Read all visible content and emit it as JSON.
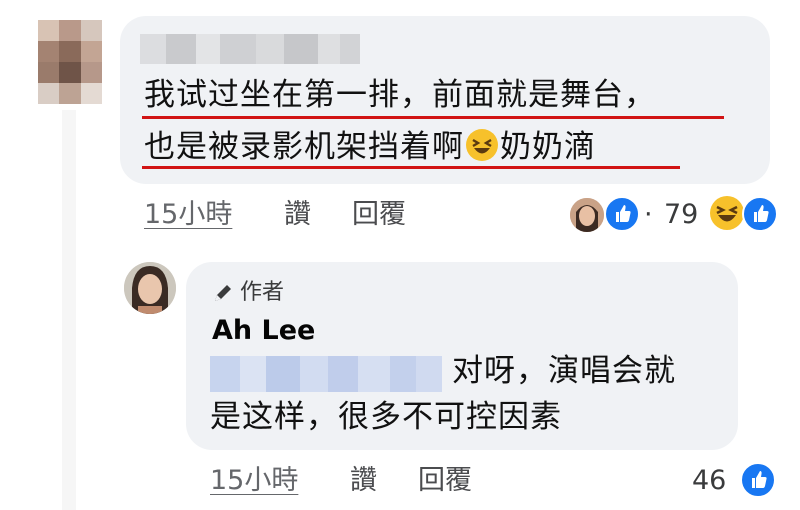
{
  "comment": {
    "text_line1": "我试过坐在第一排，前面就是舞台，",
    "text_line2_before_emoji": "也是被录影机架挡着啊",
    "text_line2_after_emoji": "奶奶滴",
    "time": "15小時",
    "like_label": "讚",
    "reply_label": "回覆",
    "reactions_separator": "·",
    "reactions_count": "79",
    "emoji": "laughing-face"
  },
  "reply": {
    "author_badge": "作者",
    "author_name": "Ah Lee",
    "text_line1": "对呀，演唱会就",
    "text_line2": "是这样，很多不可控因素",
    "time": "15小時",
    "like_label": "讚",
    "reply_label": "回覆",
    "reactions_count": "46"
  },
  "colors": {
    "bubble": "#f0f2f5",
    "underline": "#d11414",
    "like_blue": "#1877f2",
    "meta_gray": "#65676b"
  }
}
